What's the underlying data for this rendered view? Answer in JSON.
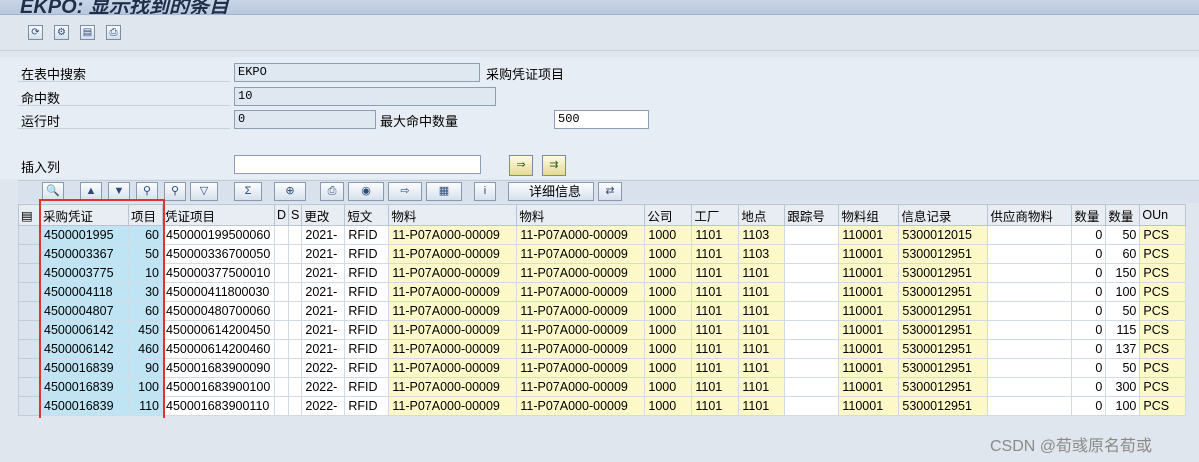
{
  "window": {
    "title": "EKPO: 显示找到的条目"
  },
  "toolbar": {
    "icons": [
      "refresh-icon",
      "filter-settings-icon",
      "select-icon",
      "print-icon"
    ]
  },
  "fields": {
    "search_table_label": "在表中搜索",
    "table_name": "EKPO",
    "table_desc": "采购凭证项目",
    "hits_label": "命中数",
    "hits_value": "10",
    "runtime_label": "运行时",
    "runtime_value": "0",
    "max_hits_label": "最大命中数量",
    "max_hits_value": "500",
    "insert_col_label": "插入列",
    "insert_col_value": ""
  },
  "grid_toolbar": {
    "detail_label": "详细信息"
  },
  "table": {
    "columns": [
      "采购凭证",
      "项目",
      "凭证项目",
      "D",
      "S",
      "更改",
      "短文",
      "物料",
      "物料",
      "公司",
      "工厂",
      "地点",
      "跟踪号",
      "物料组",
      "信息记录",
      "供应商物料",
      "数量",
      "数量",
      "OUn"
    ],
    "rows": [
      [
        "4500001995",
        "60",
        "450000199500060",
        "",
        "",
        "2021-",
        "RFID",
        "11-P07A000-00009",
        "11-P07A000-00009",
        "1000",
        "1101",
        "1103",
        "",
        "110001",
        "5300012015",
        "",
        "0",
        "50",
        "PCS"
      ],
      [
        "4500003367",
        "50",
        "450000336700050",
        "",
        "",
        "2021-",
        "RFID",
        "11-P07A000-00009",
        "11-P07A000-00009",
        "1000",
        "1101",
        "1103",
        "",
        "110001",
        "5300012951",
        "",
        "0",
        "60",
        "PCS"
      ],
      [
        "4500003775",
        "10",
        "450000377500010",
        "",
        "",
        "2021-",
        "RFID",
        "11-P07A000-00009",
        "11-P07A000-00009",
        "1000",
        "1101",
        "1101",
        "",
        "110001",
        "5300012951",
        "",
        "0",
        "150",
        "PCS"
      ],
      [
        "4500004118",
        "30",
        "450000411800030",
        "",
        "",
        "2021-",
        "RFID",
        "11-P07A000-00009",
        "11-P07A000-00009",
        "1000",
        "1101",
        "1101",
        "",
        "110001",
        "5300012951",
        "",
        "0",
        "100",
        "PCS"
      ],
      [
        "4500004807",
        "60",
        "450000480700060",
        "",
        "",
        "2021-",
        "RFID",
        "11-P07A000-00009",
        "11-P07A000-00009",
        "1000",
        "1101",
        "1101",
        "",
        "110001",
        "5300012951",
        "",
        "0",
        "50",
        "PCS"
      ],
      [
        "4500006142",
        "450",
        "450000614200450",
        "",
        "",
        "2021-",
        "RFID",
        "11-P07A000-00009",
        "11-P07A000-00009",
        "1000",
        "1101",
        "1101",
        "",
        "110001",
        "5300012951",
        "",
        "0",
        "115",
        "PCS"
      ],
      [
        "4500006142",
        "460",
        "450000614200460",
        "",
        "",
        "2021-",
        "RFID",
        "11-P07A000-00009",
        "11-P07A000-00009",
        "1000",
        "1101",
        "1101",
        "",
        "110001",
        "5300012951",
        "",
        "0",
        "137",
        "PCS"
      ],
      [
        "4500016839",
        "90",
        "450001683900090",
        "",
        "",
        "2022-",
        "RFID",
        "11-P07A000-00009",
        "11-P07A000-00009",
        "1000",
        "1101",
        "1101",
        "",
        "110001",
        "5300012951",
        "",
        "0",
        "50",
        "PCS"
      ],
      [
        "4500016839",
        "100",
        "450001683900100",
        "",
        "",
        "2022-",
        "RFID",
        "11-P07A000-00009",
        "11-P07A000-00009",
        "1000",
        "1101",
        "1101",
        "",
        "110001",
        "5300012951",
        "",
        "0",
        "300",
        "PCS"
      ],
      [
        "4500016839",
        "110",
        "450001683900110",
        "",
        "",
        "2022-",
        "RFID",
        "11-P07A000-00009",
        "11-P07A000-00009",
        "1000",
        "1101",
        "1101",
        "",
        "110001",
        "5300012951",
        "",
        "0",
        "100",
        "PCS"
      ]
    ]
  },
  "watermark": "CSDN @荀彧原名荀或",
  "colors": {
    "key_cell": "#bfe4f4",
    "yellow_cell": "#fdf8c7",
    "highlight_box": "#e0332f"
  }
}
